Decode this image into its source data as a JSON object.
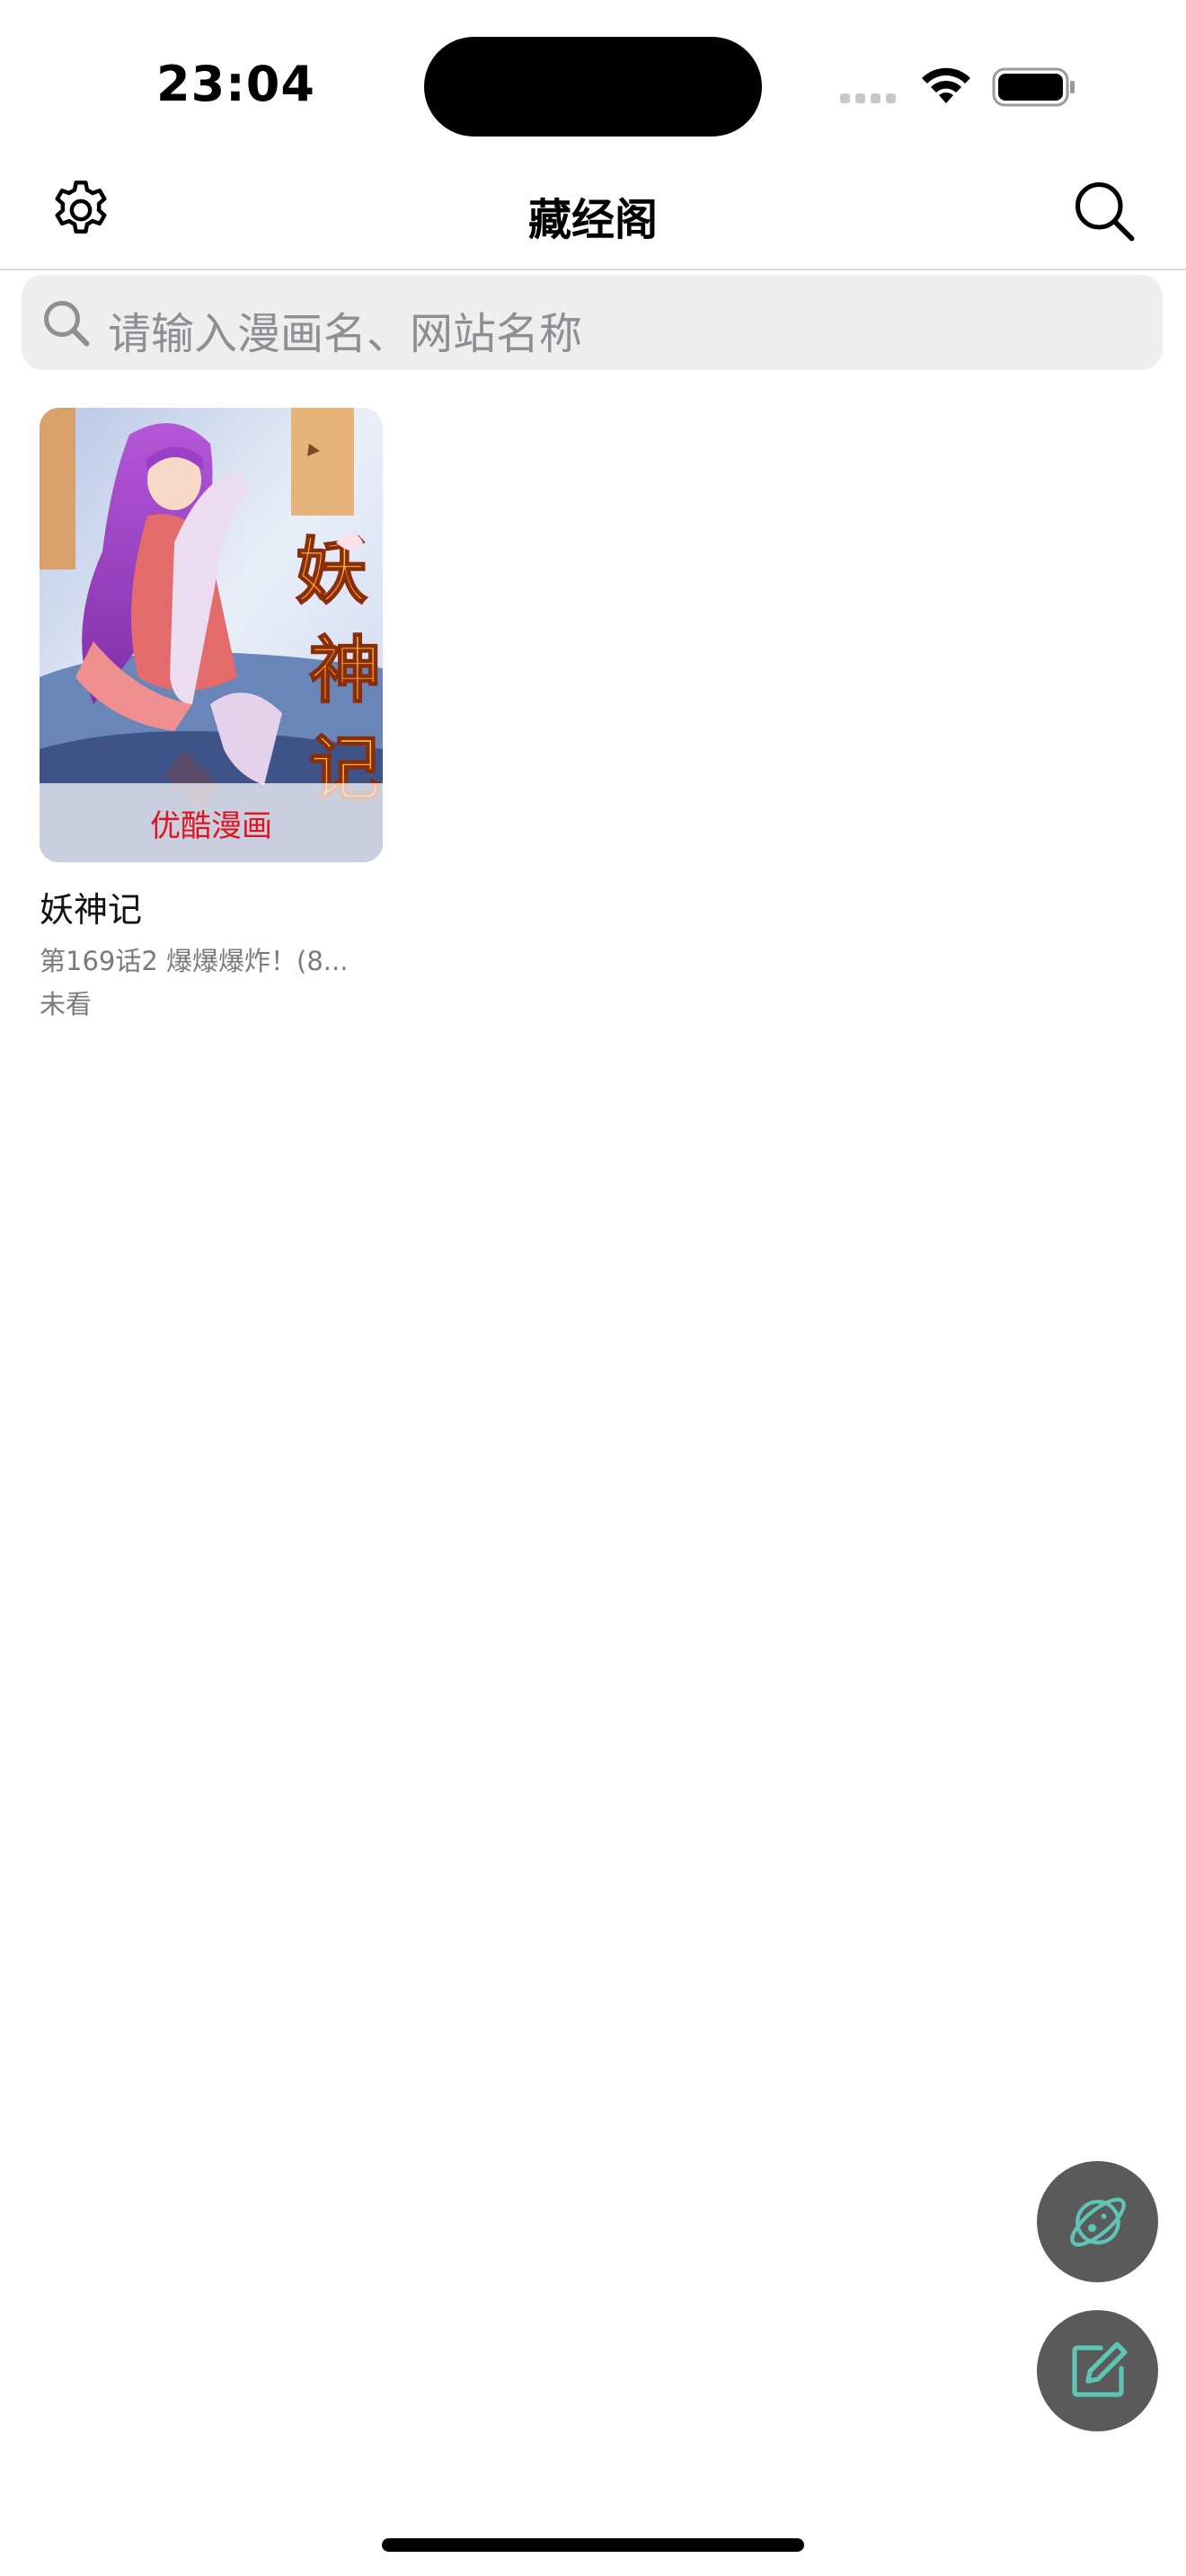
{
  "status_bar": {
    "time": "23:04"
  },
  "nav": {
    "title": "藏经阁",
    "left_icon": "gear-icon",
    "right_icon": "search-icon"
  },
  "search": {
    "placeholder": "请输入漫画名、网站名称"
  },
  "comics": [
    {
      "title": "妖神记",
      "source": "优酷漫画",
      "latest_chapter": "第169话2 爆爆爆炸！(8...",
      "read_status": "未看"
    }
  ],
  "fabs": [
    {
      "icon": "planet-icon"
    },
    {
      "icon": "edit-icon"
    }
  ],
  "colors": {
    "accent_teal": "#5ec4b6",
    "fab_bg": "#5a5a5a",
    "source_badge": "#e0141e"
  }
}
